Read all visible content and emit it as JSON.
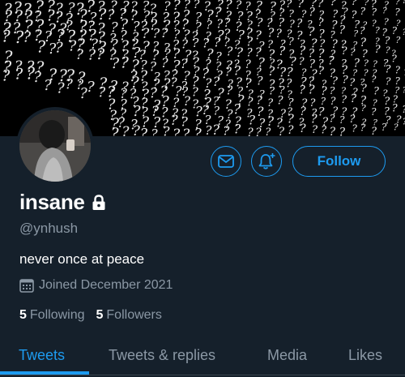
{
  "profile": {
    "name": "insane",
    "handle": "@ynhush",
    "bio": "never once at peace",
    "joined": "Joined December 2021",
    "lock_icon": "lock-icon",
    "calendar_icon": "calendar-icon"
  },
  "banner": {
    "glyph": "?",
    "background": "#000000"
  },
  "actions": {
    "message_icon": "mail-icon",
    "notify_icon": "bell-plus-icon",
    "follow_label": "Follow"
  },
  "stats": {
    "following_count": "5",
    "following_label": "Following",
    "followers_count": "5",
    "followers_label": "Followers"
  },
  "tabs": [
    {
      "label": "Tweets",
      "active": true
    },
    {
      "label": "Tweets & replies",
      "active": false
    },
    {
      "label": "Media",
      "active": false
    },
    {
      "label": "Likes",
      "active": false
    }
  ],
  "colors": {
    "background": "#15202b",
    "accent": "#1d9bf0",
    "secondary_text": "#8b98a5",
    "divider": "#38444d"
  }
}
